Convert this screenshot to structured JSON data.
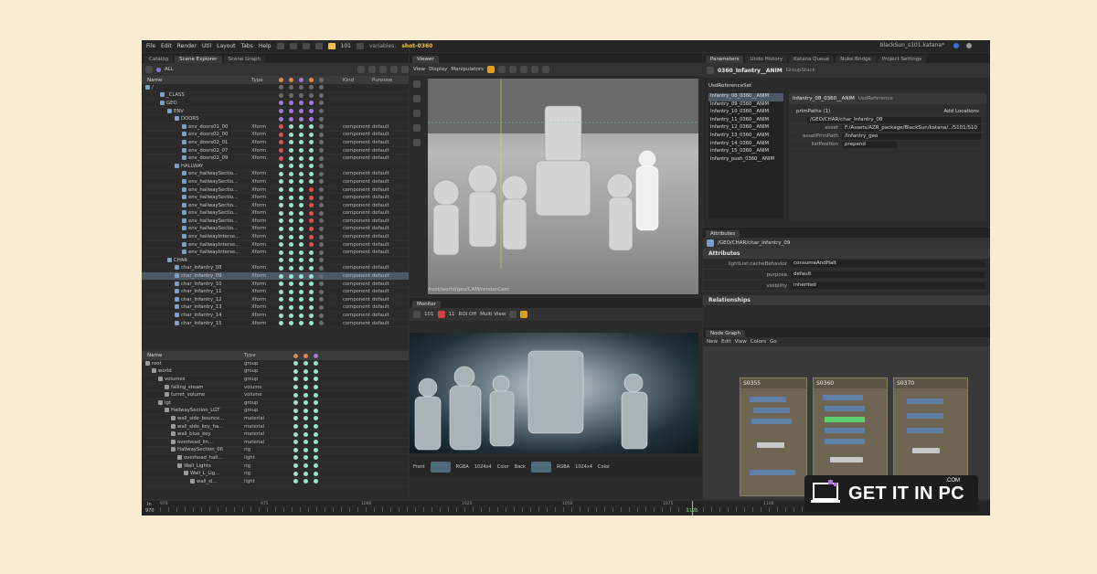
{
  "menu": [
    "File",
    "Edit",
    "Render",
    "Util",
    "Layout",
    "Tabs",
    "Help"
  ],
  "toolbar": {
    "frame": "101",
    "variables_label": "variables:",
    "shot": "shot-0360",
    "project": "blackSun_s101.katana*"
  },
  "left_tabs": [
    "Catalog",
    "Scene Explorer",
    "Scene Graph"
  ],
  "scene_explorer": {
    "filter": "ALL",
    "columns": {
      "name": "Name",
      "type": "Type",
      "kind": "Kind",
      "purpose": "Purpose"
    },
    "rows": [
      {
        "name": "/",
        "type": "",
        "kind": "",
        "purpose": "",
        "indent": 0,
        "dots": "ggggg"
      },
      {
        "name": "_CLASS",
        "type": "",
        "kind": "",
        "purpose": "",
        "indent": 2,
        "dots": "ggggg"
      },
      {
        "name": "GEO",
        "type": "",
        "kind": "",
        "purpose": "",
        "indent": 2,
        "dots": "ppppg"
      },
      {
        "name": "ENV",
        "type": "",
        "kind": "",
        "purpose": "",
        "indent": 3,
        "dots": "ppppg"
      },
      {
        "name": "DOORS",
        "type": "",
        "kind": "",
        "purpose": "",
        "indent": 4,
        "dots": "ppppg"
      },
      {
        "name": "env_doors01_00",
        "type": "Xform",
        "kind": "component",
        "purpose": "default",
        "indent": 5,
        "dots": "rmmmg"
      },
      {
        "name": "env_doors02_00",
        "type": "Xform",
        "kind": "component",
        "purpose": "default",
        "indent": 5,
        "dots": "rmmmg"
      },
      {
        "name": "env_doors02_01",
        "type": "Xform",
        "kind": "component",
        "purpose": "default",
        "indent": 5,
        "dots": "rmmmg"
      },
      {
        "name": "env_doors02_07",
        "type": "Xform",
        "kind": "component",
        "purpose": "default",
        "indent": 5,
        "dots": "rmmmg"
      },
      {
        "name": "env_doors02_09",
        "type": "Xform",
        "kind": "component",
        "purpose": "default",
        "indent": 5,
        "dots": "rmmmg"
      },
      {
        "name": "HALLWAY",
        "type": "",
        "kind": "",
        "purpose": "",
        "indent": 4,
        "dots": "mmmmg"
      },
      {
        "name": "env_hallwaySectio...",
        "type": "Xform",
        "kind": "component",
        "purpose": "default",
        "indent": 5,
        "dots": "mmmmg"
      },
      {
        "name": "env_hallwaySectio...",
        "type": "Xform",
        "kind": "component",
        "purpose": "default",
        "indent": 5,
        "dots": "mmmmg"
      },
      {
        "name": "env_hallwaySectio...",
        "type": "Xform",
        "kind": "component",
        "purpose": "default",
        "indent": 5,
        "dots": "mmmrg"
      },
      {
        "name": "env_hallwaySectio...",
        "type": "Xform",
        "kind": "component",
        "purpose": "default",
        "indent": 5,
        "dots": "mmmrg"
      },
      {
        "name": "env_hallwaySectio...",
        "type": "Xform",
        "kind": "component",
        "purpose": "default",
        "indent": 5,
        "dots": "mmmrg"
      },
      {
        "name": "env_hallwaySectio...",
        "type": "Xform",
        "kind": "component",
        "purpose": "default",
        "indent": 5,
        "dots": "mmmrg"
      },
      {
        "name": "env_hallwaySectio...",
        "type": "Xform",
        "kind": "component",
        "purpose": "default",
        "indent": 5,
        "dots": "mmmrg"
      },
      {
        "name": "env_hallwaySectio...",
        "type": "Xform",
        "kind": "component",
        "purpose": "default",
        "indent": 5,
        "dots": "mmmrg"
      },
      {
        "name": "env_hallwayInterse...",
        "type": "Xform",
        "kind": "component",
        "purpose": "default",
        "indent": 5,
        "dots": "mmmrg"
      },
      {
        "name": "env_hallwayInterse...",
        "type": "Xform",
        "kind": "component",
        "purpose": "default",
        "indent": 5,
        "dots": "mmmrg"
      },
      {
        "name": "env_hallwayInterse...",
        "type": "Xform",
        "kind": "component",
        "purpose": "default",
        "indent": 5,
        "dots": "mmmmg"
      },
      {
        "name": "CHAR",
        "type": "",
        "kind": "",
        "purpose": "",
        "indent": 3,
        "dots": "mmmmg"
      },
      {
        "name": "char_Infantry_08",
        "type": "Xform",
        "kind": "component",
        "purpose": "default",
        "indent": 4,
        "dots": "mmmmg"
      },
      {
        "name": "char_Infantry_09",
        "type": "Xform",
        "kind": "component",
        "purpose": "default",
        "indent": 4,
        "dots": "mmmmg",
        "selected": true
      },
      {
        "name": "char_Infantry_10",
        "type": "Xform",
        "kind": "component",
        "purpose": "default",
        "indent": 4,
        "dots": "mmmmg"
      },
      {
        "name": "char_Infantry_11",
        "type": "Xform",
        "kind": "component",
        "purpose": "default",
        "indent": 4,
        "dots": "mmmmg"
      },
      {
        "name": "char_Infantry_12",
        "type": "Xform",
        "kind": "component",
        "purpose": "default",
        "indent": 4,
        "dots": "mmmmg"
      },
      {
        "name": "char_Infantry_13",
        "type": "Xform",
        "kind": "component",
        "purpose": "default",
        "indent": 4,
        "dots": "mmmmg"
      },
      {
        "name": "char_Infantry_14",
        "type": "Xform",
        "kind": "component",
        "purpose": "default",
        "indent": 4,
        "dots": "mmmmg"
      },
      {
        "name": "char_Infantry_15",
        "type": "Xform",
        "kind": "component",
        "purpose": "default",
        "indent": 4,
        "dots": "mmmmg"
      }
    ]
  },
  "scene_graph": {
    "columns": {
      "name": "Name",
      "type": "Type"
    },
    "rows": [
      {
        "name": "root",
        "type": "group",
        "indent": 0
      },
      {
        "name": "world",
        "type": "group",
        "indent": 1
      },
      {
        "name": "volumes",
        "type": "group",
        "indent": 2
      },
      {
        "name": "falling_steam",
        "type": "volume",
        "indent": 3
      },
      {
        "name": "turret_volume",
        "type": "volume",
        "indent": 3
      },
      {
        "name": "lgt",
        "type": "group",
        "indent": 2
      },
      {
        "name": "HallwaySection_LGT",
        "type": "group",
        "indent": 3
      },
      {
        "name": "wall_side_bounce...",
        "type": "material",
        "indent": 4
      },
      {
        "name": "wall_side_key_ha...",
        "type": "material",
        "indent": 4
      },
      {
        "name": "wall_blue_key",
        "type": "material",
        "indent": 4
      },
      {
        "name": "overhead_lin...",
        "type": "material",
        "indent": 4
      },
      {
        "name": "HallwaySection_06",
        "type": "rig",
        "indent": 4
      },
      {
        "name": "overhead_hall...",
        "type": "light",
        "indent": 5
      },
      {
        "name": "Wall_Lights",
        "type": "rig",
        "indent": 5
      },
      {
        "name": "Wall_L_Lig...",
        "type": "rig",
        "indent": 6
      },
      {
        "name": "wall_sl...",
        "type": "light",
        "indent": 7
      }
    ]
  },
  "viewer": {
    "tab": "Viewer",
    "menus": [
      "View",
      "Display",
      "Manipulators"
    ],
    "camera_path": "/root/world/geo/CAM/renderCam"
  },
  "monitor": {
    "tab": "Monitor",
    "roi": "ROI Off",
    "view": "Multi View",
    "frame_a": "101",
    "frame_b": "11",
    "bottom_left": {
      "label": "Front",
      "size": "1024x4",
      "mode": "RGBA",
      "channel": "Color"
    },
    "bottom_right": {
      "label": "Back",
      "size": "1024x4",
      "mode": "RGBA",
      "channel": "Color"
    }
  },
  "right_tabs": [
    "Parameters",
    "Undo History",
    "Katana Queue",
    "Nuke Bridge",
    "Project Settings"
  ],
  "parameters": {
    "node_name": "0360_Infantry__ANIM",
    "node_type": "GroupStack",
    "subnode": "UsdReferenceSet",
    "list": [
      "Infantry_08_0360__ANIM",
      "Infantry_09_0360__ANIM",
      "Infantry_10_0360__ANIM",
      "Infantry_11_0360__ANIM",
      "Infantry_12_0360__ANIM",
      "Infantry_13_0360__ANIM",
      "Infantry_14_0360__ANIM",
      "Infantry_15_0360__ANIM",
      "Infantry_push_0360__ANIM"
    ],
    "inner_node": "Infantry_08_0360__ANIM",
    "inner_type": "UsdReference",
    "prim_paths": "primPaths (1)",
    "add_locations": "Add Locations",
    "prim_value": "/GEO/CHAR/char_Infantry_08",
    "asset_label": "asset",
    "asset_value": "F:/Assets/AZR_package/BlackSun/katana/../S101/S10",
    "asset_prim_label": "assetPrimPath",
    "asset_prim_value": "/Infantry_geo",
    "list_pos_label": "listPosition",
    "list_pos_value": "prepend"
  },
  "attributes": {
    "tab": "Attributes",
    "path": "/GEO/CHAR/char_Infantry_09",
    "section": "Attributes",
    "rows": [
      {
        "label": "lightList:cacheBehavior",
        "value": "consumeAndHalt"
      },
      {
        "label": "purpose",
        "value": "default"
      },
      {
        "label": "visibility",
        "value": "inherited"
      }
    ],
    "relationships": "Relationships"
  },
  "node_graph": {
    "tab": "Node Graph",
    "menus": [
      "New",
      "Edit",
      "View",
      "Colors",
      "Go"
    ],
    "boxes": [
      "S0355",
      "S0360",
      "S0370"
    ]
  },
  "timeline": {
    "in_label": "In",
    "start": "970",
    "labels": [
      "970",
      "975",
      "1000",
      "1025",
      "1050",
      "1075",
      "1100",
      "1125",
      "1150"
    ],
    "current": "1125"
  },
  "watermark": {
    "text": "GET IT IN PC",
    "com": ".COM"
  },
  "colors": {
    "accent": "#f0c040",
    "selection": "#4d5866",
    "dot_green": "#9ee2c9",
    "dot_red": "#e05050"
  }
}
